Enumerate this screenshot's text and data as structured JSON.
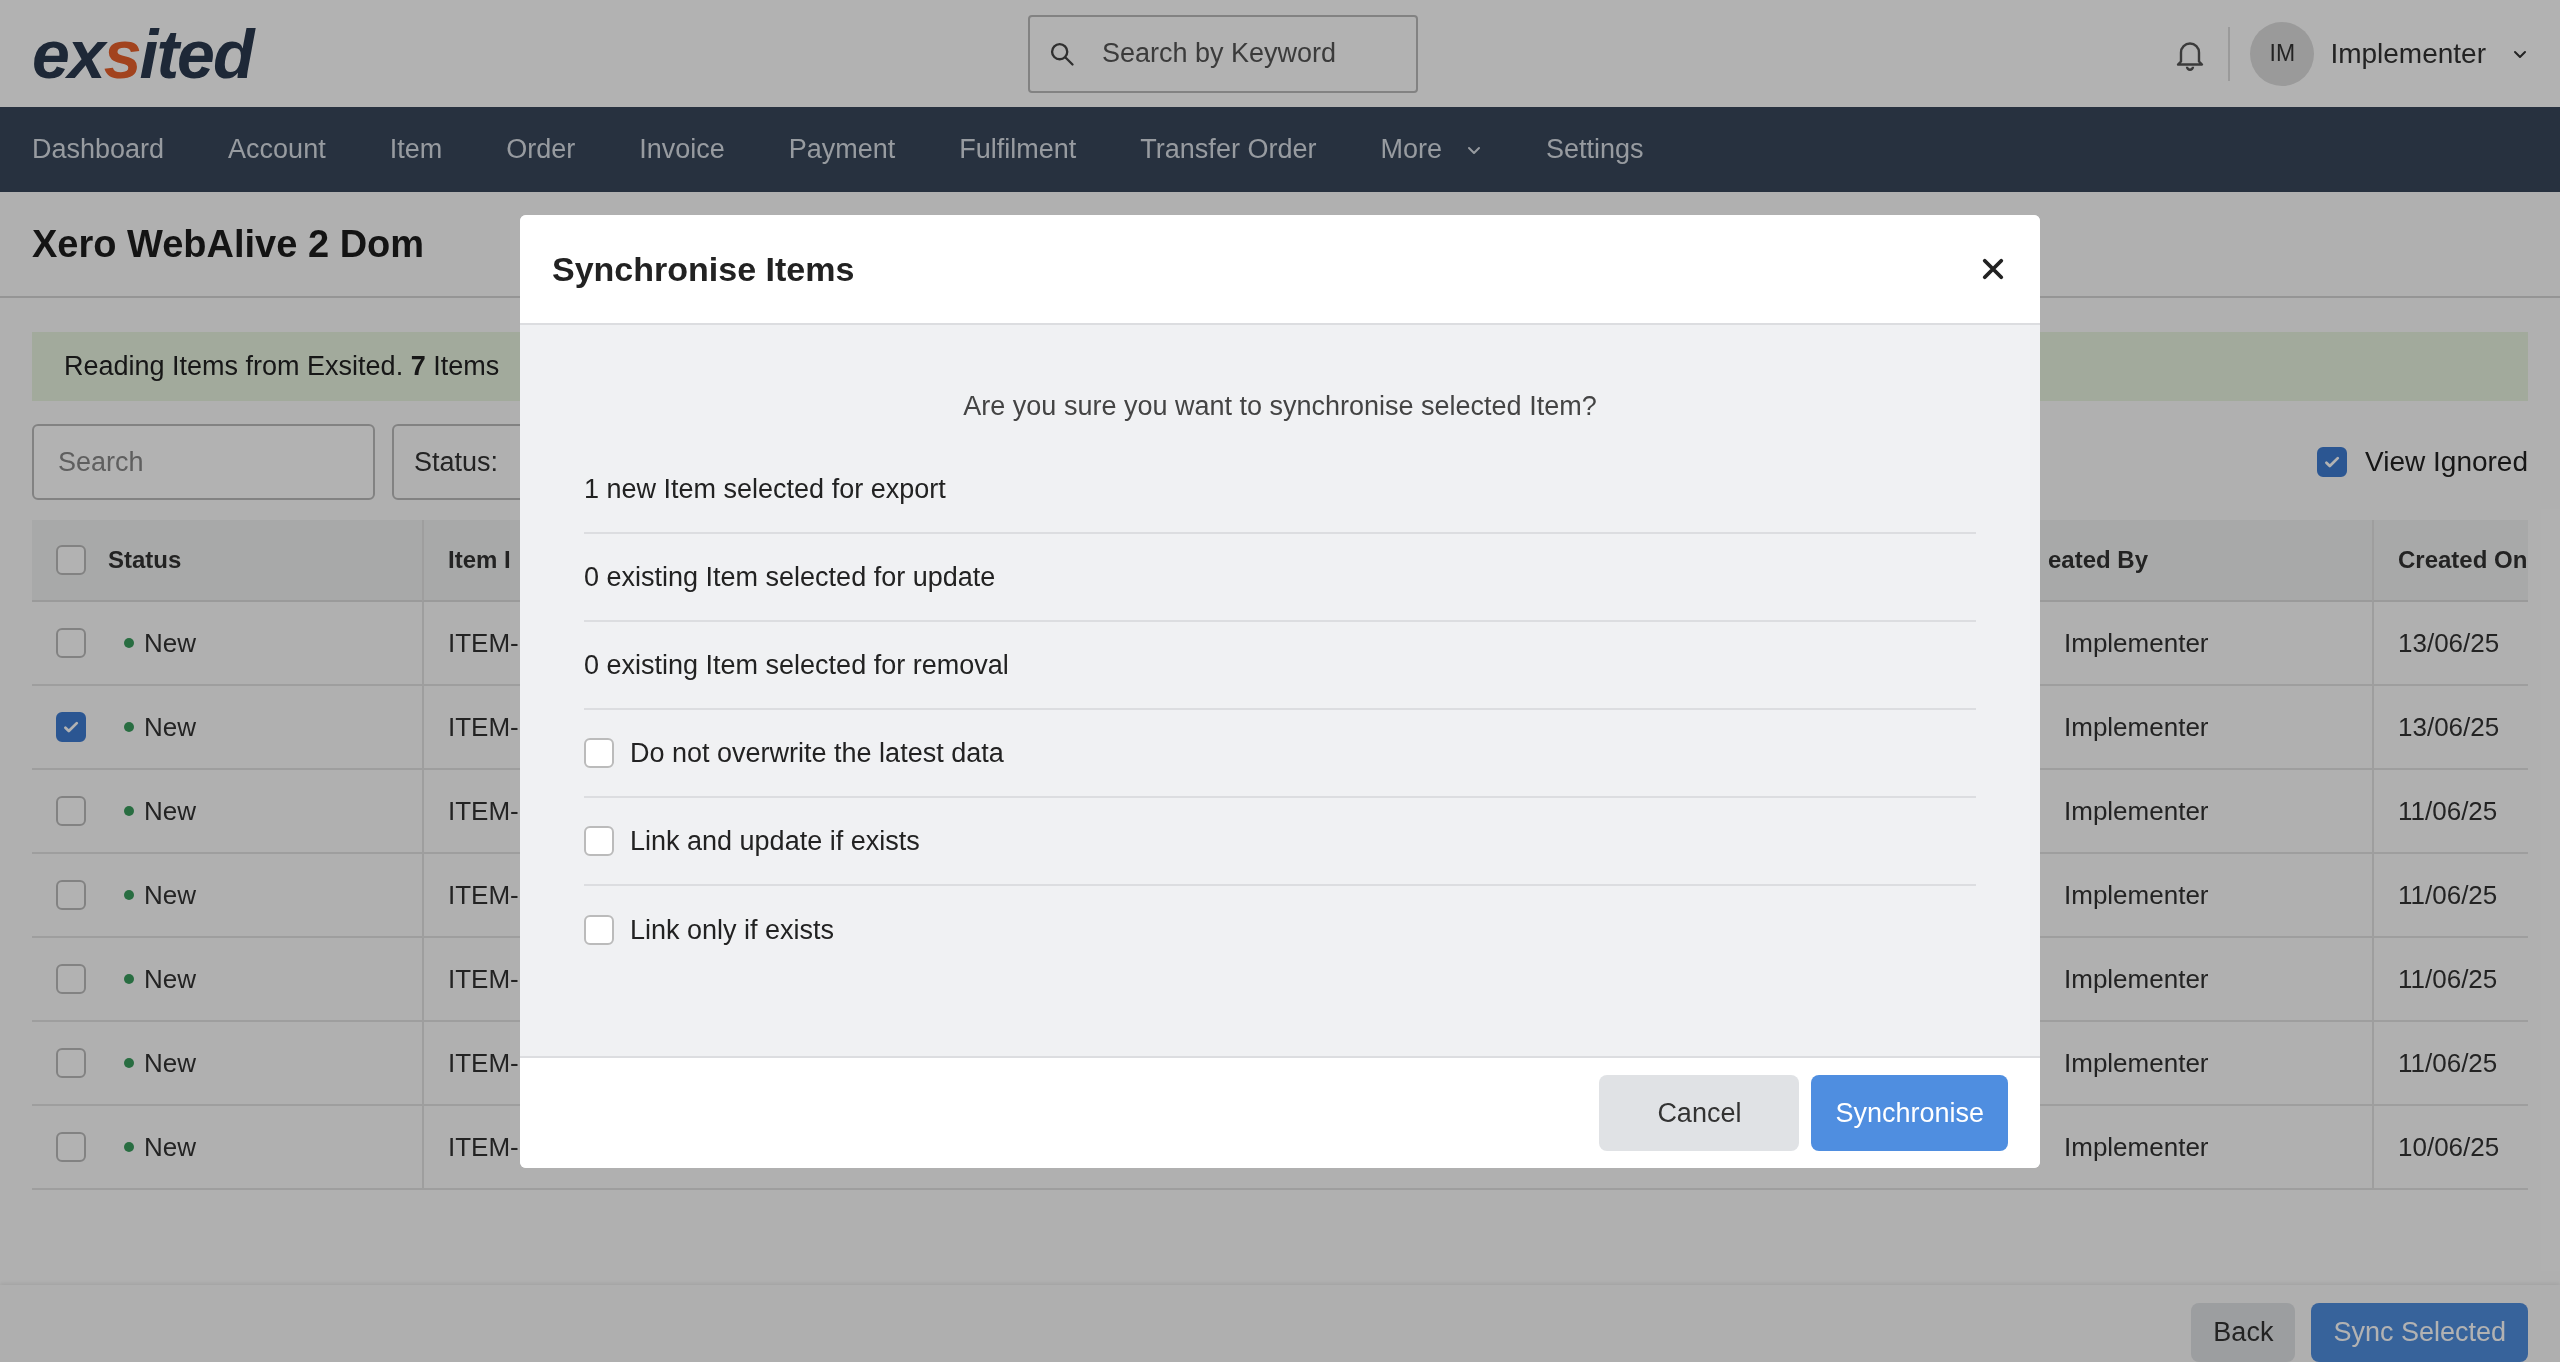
{
  "header": {
    "logo": "exsited",
    "search": {
      "placeholder": "Search by Keyword"
    },
    "user": {
      "initials": "IM",
      "name": "Implementer"
    }
  },
  "nav": [
    {
      "label": "Dashboard",
      "dropdown": false
    },
    {
      "label": "Account",
      "dropdown": false
    },
    {
      "label": "Item",
      "dropdown": false
    },
    {
      "label": "Order",
      "dropdown": false
    },
    {
      "label": "Invoice",
      "dropdown": false
    },
    {
      "label": "Payment",
      "dropdown": false
    },
    {
      "label": "Fulfilment",
      "dropdown": false
    },
    {
      "label": "Transfer Order",
      "dropdown": false
    },
    {
      "label": "More",
      "dropdown": true
    },
    {
      "label": "Settings",
      "dropdown": false
    }
  ],
  "page": {
    "title": "Xero WebAlive 2 Dom",
    "banner": "Reading Items from Exsited. **7** Items",
    "filters": {
      "search": {
        "placeholder": "Search"
      },
      "status": {
        "label": "Status:"
      },
      "view_ignored": {
        "label": "View Ignored",
        "checked": true
      }
    }
  },
  "table": {
    "select_all_checked": false,
    "columns": [
      "Status",
      "Item I",
      "eated By",
      "Created On"
    ],
    "rows": [
      {
        "checked": false,
        "status": "New",
        "item_id": "ITEM-",
        "created_by": "Implementer",
        "created_on": "13/06/25"
      },
      {
        "checked": true,
        "status": "New",
        "item_id": "ITEM-",
        "created_by": "Implementer",
        "created_on": "13/06/25"
      },
      {
        "checked": false,
        "status": "New",
        "item_id": "ITEM-",
        "created_by": "Implementer",
        "created_on": "11/06/25"
      },
      {
        "checked": false,
        "status": "New",
        "item_id": "ITEM-",
        "created_by": "Implementer",
        "created_on": "11/06/25"
      },
      {
        "checked": false,
        "status": "New",
        "item_id": "ITEM-",
        "created_by": "Implementer",
        "created_on": "11/06/25"
      },
      {
        "checked": false,
        "status": "New",
        "item_id": "ITEM-",
        "created_by": "Implementer",
        "created_on": "11/06/25"
      },
      {
        "checked": false,
        "status": "New",
        "item_id": "ITEM-",
        "created_by": "Implementer",
        "created_on": "10/06/25"
      }
    ]
  },
  "actions": [
    {
      "label": "Back",
      "kind": "secondary"
    },
    {
      "label": "Sync Selected",
      "kind": "primary"
    }
  ],
  "modal": {
    "title": "Synchronise Items",
    "question": "Are you sure you want to synchronise selected Item?",
    "summary": [
      "1 new Item selected for export",
      "0 existing Item selected for update",
      "0 existing Item selected for removal"
    ],
    "options": [
      {
        "label": "Do not overwrite the latest data",
        "checked": false
      },
      {
        "label": "Link and update if exists",
        "checked": false
      },
      {
        "label": "Link only if exists",
        "checked": false
      }
    ],
    "buttons": [
      {
        "label": "Cancel",
        "kind": "secondary"
      },
      {
        "label": "Synchronise",
        "kind": "primary"
      }
    ]
  }
}
